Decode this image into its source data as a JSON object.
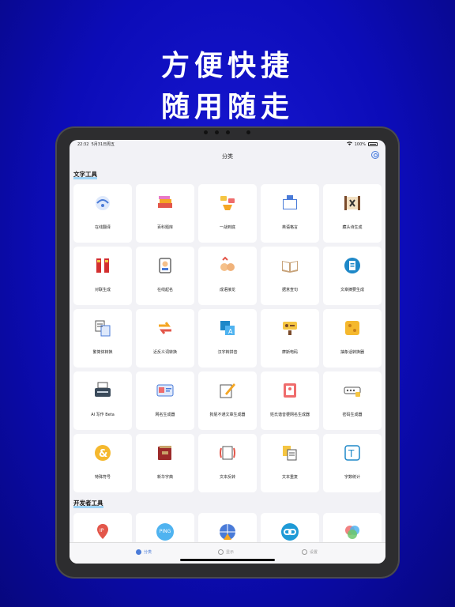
{
  "headline": {
    "line1": "方便快捷",
    "line2": "随用随走"
  },
  "status": {
    "time": "22:32",
    "date": "5月31日周五",
    "battery": "100%"
  },
  "nav": {
    "title": "分类"
  },
  "sections": [
    {
      "title": "文字工具",
      "items": [
        {
          "label": "在线翻译",
          "icon": "translate-globe-icon"
        },
        {
          "label": "百科题库",
          "icon": "books-stack-icon"
        },
        {
          "label": "一战到底",
          "icon": "quiz-trophy-icon"
        },
        {
          "label": "英语格言",
          "icon": "english-book-icon"
        },
        {
          "label": "藏头诗生成",
          "icon": "scroll-poem-icon"
        },
        {
          "label": "对联生成",
          "icon": "couplet-icon"
        },
        {
          "label": "在线起名",
          "icon": "name-badge-icon"
        },
        {
          "label": "成语接龙",
          "icon": "hands-icon"
        },
        {
          "label": "据意查句",
          "icon": "open-book-icon"
        },
        {
          "label": "文章摘要生成",
          "icon": "document-summary-icon"
        },
        {
          "label": "繁简体转换",
          "icon": "convert-doc-icon"
        },
        {
          "label": "近反义词转换",
          "icon": "swap-arrows-icon"
        },
        {
          "label": "汉字转拼音",
          "icon": "pinyin-icon"
        },
        {
          "label": "摩斯电码",
          "icon": "morse-code-icon"
        },
        {
          "label": "抽象话转换器",
          "icon": "emoji-grid-icon"
        },
        {
          "label": "AI 写作 Beta",
          "icon": "typewriter-icon"
        },
        {
          "label": "网名生成器",
          "icon": "id-card-icon"
        },
        {
          "label": "狗屁不通文章生成器",
          "icon": "pen-paper-icon"
        },
        {
          "label": "姓氏谐音梗网名生成器",
          "icon": "contact-book-icon"
        },
        {
          "label": "密码生成器",
          "icon": "password-icon"
        },
        {
          "label": "特殊符号",
          "icon": "ampersand-icon"
        },
        {
          "label": "新华字典",
          "icon": "dictionary-icon"
        },
        {
          "label": "文本反转",
          "icon": "text-reverse-icon"
        },
        {
          "label": "文本重复",
          "icon": "text-repeat-icon"
        },
        {
          "label": "字数统计",
          "icon": "word-count-icon"
        }
      ]
    },
    {
      "title": "开发者工具",
      "items": [
        {
          "label": "",
          "icon": "ip-location-icon"
        },
        {
          "label": "",
          "icon": "ping-icon",
          "badge": "PING"
        },
        {
          "label": "",
          "icon": "network-globe-icon"
        },
        {
          "label": "",
          "icon": "link-icon"
        },
        {
          "label": "",
          "icon": "rgb-circles-icon"
        }
      ]
    }
  ],
  "tabs": [
    {
      "label": "分类",
      "active": true
    },
    {
      "label": "显示",
      "active": false
    },
    {
      "label": "设置",
      "active": false
    }
  ],
  "colors": {
    "background": "#0c0cb8",
    "accent": "#4a7bd8",
    "highlight": "#9fd4f7",
    "orange": "#f5a623"
  }
}
